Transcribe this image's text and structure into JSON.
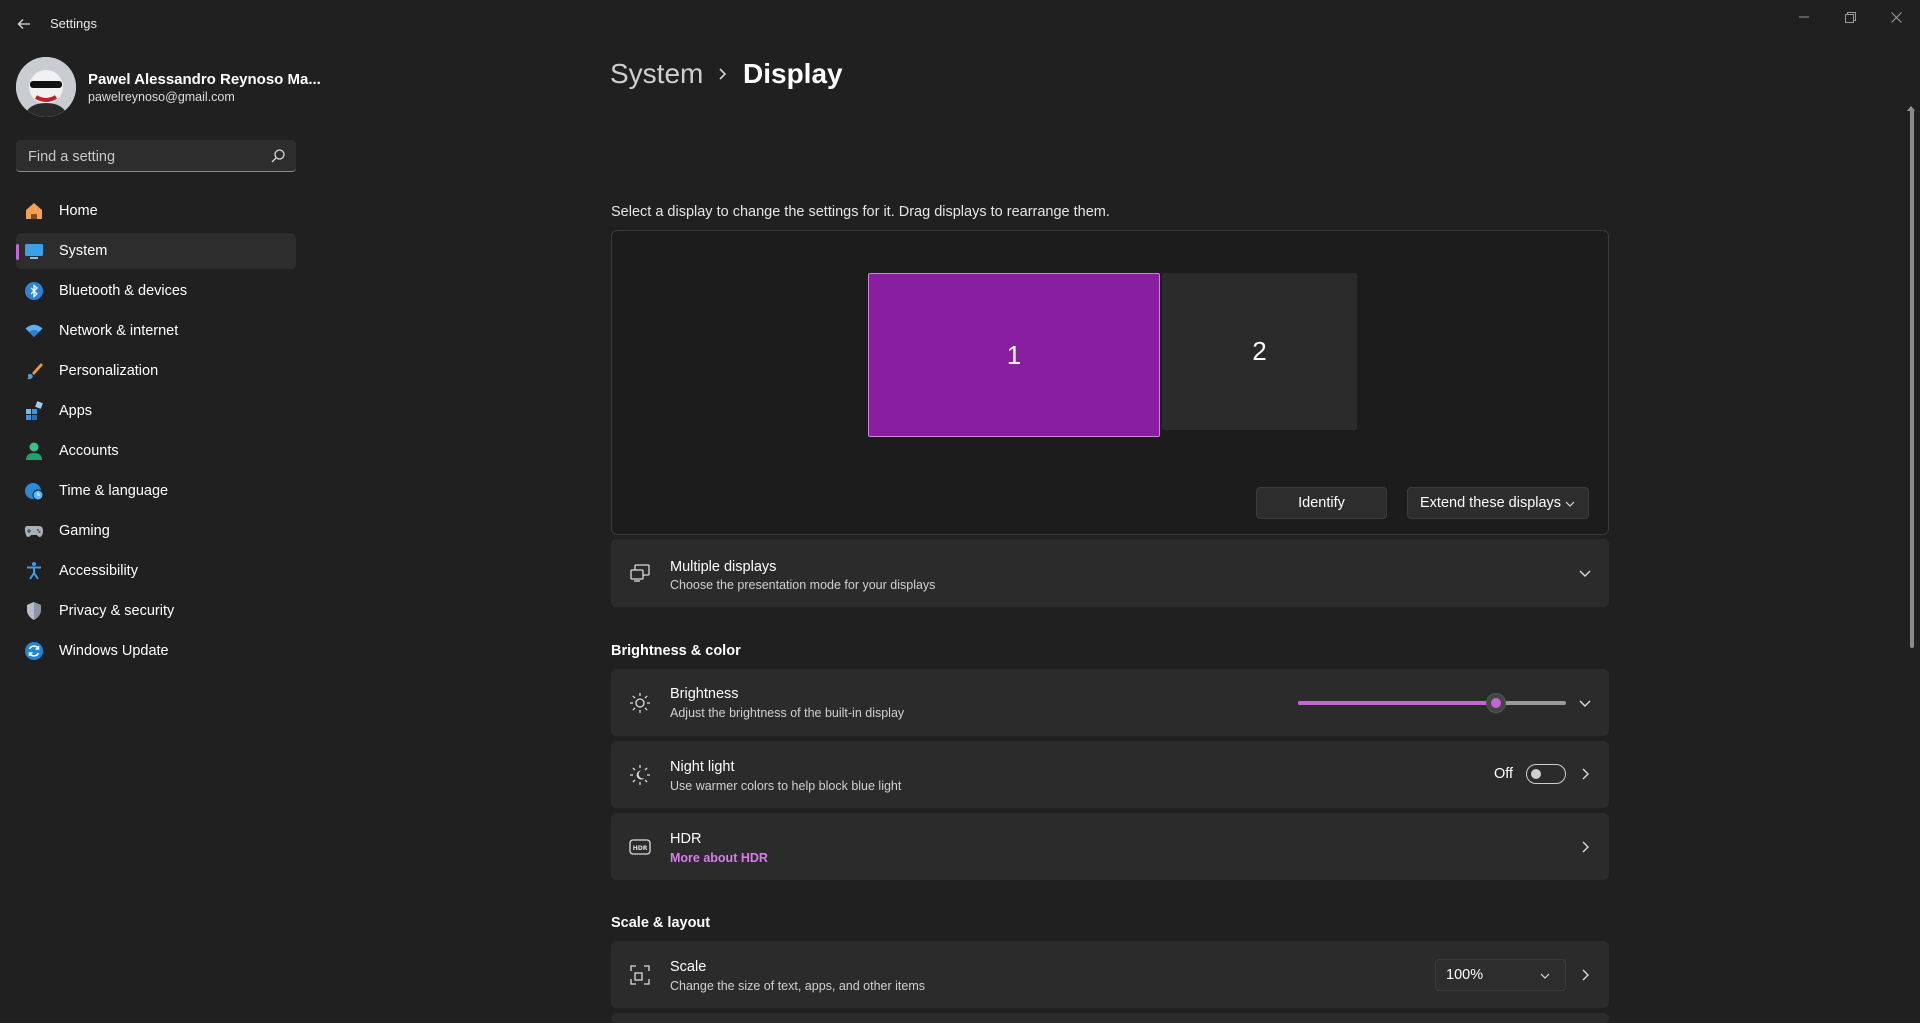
{
  "window": {
    "title": "Settings"
  },
  "profile": {
    "name": "Pawel Alessandro Reynoso Ma...",
    "email": "pawelreynoso@gmail.com"
  },
  "search": {
    "placeholder": "Find a setting"
  },
  "sidebar": {
    "items": [
      {
        "label": "Home",
        "icon": "home-icon"
      },
      {
        "label": "System",
        "icon": "system-icon",
        "active": true
      },
      {
        "label": "Bluetooth & devices",
        "icon": "bluetooth-icon"
      },
      {
        "label": "Network & internet",
        "icon": "wifi-icon"
      },
      {
        "label": "Personalization",
        "icon": "brush-icon"
      },
      {
        "label": "Apps",
        "icon": "apps-icon"
      },
      {
        "label": "Accounts",
        "icon": "person-icon"
      },
      {
        "label": "Time & language",
        "icon": "globe-clock-icon"
      },
      {
        "label": "Gaming",
        "icon": "gamepad-icon"
      },
      {
        "label": "Accessibility",
        "icon": "accessibility-icon"
      },
      {
        "label": "Privacy & security",
        "icon": "shield-icon"
      },
      {
        "label": "Windows Update",
        "icon": "update-icon"
      }
    ]
  },
  "breadcrumb": {
    "parent": "System",
    "current": "Display"
  },
  "display_arrangement": {
    "hint": "Select a display to change the settings for it. Drag displays to rearrange them.",
    "monitors": [
      "1",
      "2"
    ],
    "selected_monitor": "1",
    "identify_label": "Identify",
    "mode_label": "Extend these displays"
  },
  "multiple_displays": {
    "title": "Multiple displays",
    "subtitle": "Choose the presentation mode for your displays"
  },
  "brightness_color": {
    "section_title": "Brightness & color",
    "brightness": {
      "title": "Brightness",
      "subtitle": "Adjust the brightness of the built-in display",
      "value_percent": 74
    },
    "night_light": {
      "title": "Night light",
      "subtitle": "Use warmer colors to help block blue light",
      "state": "Off"
    },
    "hdr": {
      "title": "HDR",
      "link": "More about HDR"
    }
  },
  "scale_layout": {
    "section_title": "Scale & layout",
    "scale": {
      "title": "Scale",
      "subtitle": "Change the size of text, apps, and other items",
      "value": "100%"
    }
  },
  "colors": {
    "accent": "#c665d6",
    "selected_monitor": "#8a1ea0",
    "background": "#202020",
    "card": "#2b2b2b"
  }
}
